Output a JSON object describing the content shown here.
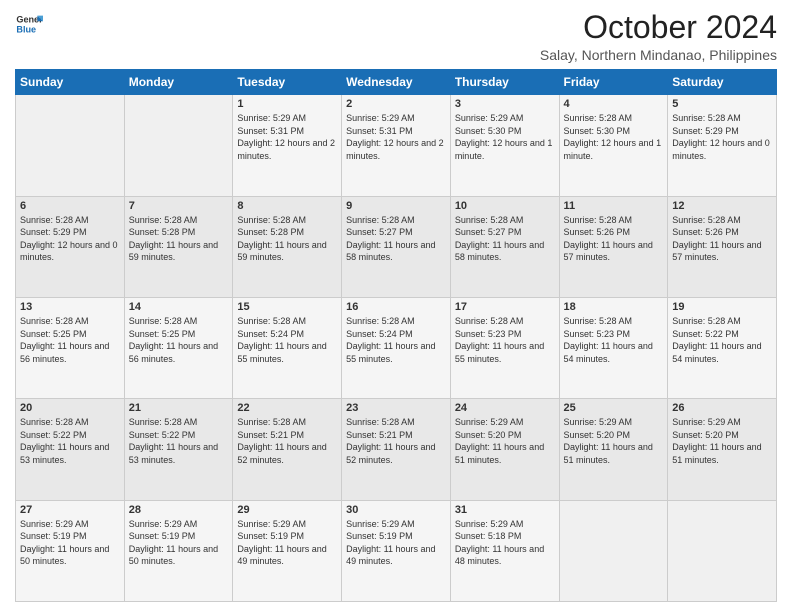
{
  "header": {
    "logo_line1": "General",
    "logo_line2": "Blue",
    "month_title": "October 2024",
    "location": "Salay, Northern Mindanao, Philippines"
  },
  "days_of_week": [
    "Sunday",
    "Monday",
    "Tuesday",
    "Wednesday",
    "Thursday",
    "Friday",
    "Saturday"
  ],
  "weeks": [
    [
      {
        "day": "",
        "sunrise": "",
        "sunset": "",
        "daylight": ""
      },
      {
        "day": "",
        "sunrise": "",
        "sunset": "",
        "daylight": ""
      },
      {
        "day": "1",
        "sunrise": "Sunrise: 5:29 AM",
        "sunset": "Sunset: 5:31 PM",
        "daylight": "Daylight: 12 hours and 2 minutes."
      },
      {
        "day": "2",
        "sunrise": "Sunrise: 5:29 AM",
        "sunset": "Sunset: 5:31 PM",
        "daylight": "Daylight: 12 hours and 2 minutes."
      },
      {
        "day": "3",
        "sunrise": "Sunrise: 5:29 AM",
        "sunset": "Sunset: 5:30 PM",
        "daylight": "Daylight: 12 hours and 1 minute."
      },
      {
        "day": "4",
        "sunrise": "Sunrise: 5:28 AM",
        "sunset": "Sunset: 5:30 PM",
        "daylight": "Daylight: 12 hours and 1 minute."
      },
      {
        "day": "5",
        "sunrise": "Sunrise: 5:28 AM",
        "sunset": "Sunset: 5:29 PM",
        "daylight": "Daylight: 12 hours and 0 minutes."
      }
    ],
    [
      {
        "day": "6",
        "sunrise": "Sunrise: 5:28 AM",
        "sunset": "Sunset: 5:29 PM",
        "daylight": "Daylight: 12 hours and 0 minutes."
      },
      {
        "day": "7",
        "sunrise": "Sunrise: 5:28 AM",
        "sunset": "Sunset: 5:28 PM",
        "daylight": "Daylight: 11 hours and 59 minutes."
      },
      {
        "day": "8",
        "sunrise": "Sunrise: 5:28 AM",
        "sunset": "Sunset: 5:28 PM",
        "daylight": "Daylight: 11 hours and 59 minutes."
      },
      {
        "day": "9",
        "sunrise": "Sunrise: 5:28 AM",
        "sunset": "Sunset: 5:27 PM",
        "daylight": "Daylight: 11 hours and 58 minutes."
      },
      {
        "day": "10",
        "sunrise": "Sunrise: 5:28 AM",
        "sunset": "Sunset: 5:27 PM",
        "daylight": "Daylight: 11 hours and 58 minutes."
      },
      {
        "day": "11",
        "sunrise": "Sunrise: 5:28 AM",
        "sunset": "Sunset: 5:26 PM",
        "daylight": "Daylight: 11 hours and 57 minutes."
      },
      {
        "day": "12",
        "sunrise": "Sunrise: 5:28 AM",
        "sunset": "Sunset: 5:26 PM",
        "daylight": "Daylight: 11 hours and 57 minutes."
      }
    ],
    [
      {
        "day": "13",
        "sunrise": "Sunrise: 5:28 AM",
        "sunset": "Sunset: 5:25 PM",
        "daylight": "Daylight: 11 hours and 56 minutes."
      },
      {
        "day": "14",
        "sunrise": "Sunrise: 5:28 AM",
        "sunset": "Sunset: 5:25 PM",
        "daylight": "Daylight: 11 hours and 56 minutes."
      },
      {
        "day": "15",
        "sunrise": "Sunrise: 5:28 AM",
        "sunset": "Sunset: 5:24 PM",
        "daylight": "Daylight: 11 hours and 55 minutes."
      },
      {
        "day": "16",
        "sunrise": "Sunrise: 5:28 AM",
        "sunset": "Sunset: 5:24 PM",
        "daylight": "Daylight: 11 hours and 55 minutes."
      },
      {
        "day": "17",
        "sunrise": "Sunrise: 5:28 AM",
        "sunset": "Sunset: 5:23 PM",
        "daylight": "Daylight: 11 hours and 55 minutes."
      },
      {
        "day": "18",
        "sunrise": "Sunrise: 5:28 AM",
        "sunset": "Sunset: 5:23 PM",
        "daylight": "Daylight: 11 hours and 54 minutes."
      },
      {
        "day": "19",
        "sunrise": "Sunrise: 5:28 AM",
        "sunset": "Sunset: 5:22 PM",
        "daylight": "Daylight: 11 hours and 54 minutes."
      }
    ],
    [
      {
        "day": "20",
        "sunrise": "Sunrise: 5:28 AM",
        "sunset": "Sunset: 5:22 PM",
        "daylight": "Daylight: 11 hours and 53 minutes."
      },
      {
        "day": "21",
        "sunrise": "Sunrise: 5:28 AM",
        "sunset": "Sunset: 5:22 PM",
        "daylight": "Daylight: 11 hours and 53 minutes."
      },
      {
        "day": "22",
        "sunrise": "Sunrise: 5:28 AM",
        "sunset": "Sunset: 5:21 PM",
        "daylight": "Daylight: 11 hours and 52 minutes."
      },
      {
        "day": "23",
        "sunrise": "Sunrise: 5:28 AM",
        "sunset": "Sunset: 5:21 PM",
        "daylight": "Daylight: 11 hours and 52 minutes."
      },
      {
        "day": "24",
        "sunrise": "Sunrise: 5:29 AM",
        "sunset": "Sunset: 5:20 PM",
        "daylight": "Daylight: 11 hours and 51 minutes."
      },
      {
        "day": "25",
        "sunrise": "Sunrise: 5:29 AM",
        "sunset": "Sunset: 5:20 PM",
        "daylight": "Daylight: 11 hours and 51 minutes."
      },
      {
        "day": "26",
        "sunrise": "Sunrise: 5:29 AM",
        "sunset": "Sunset: 5:20 PM",
        "daylight": "Daylight: 11 hours and 51 minutes."
      }
    ],
    [
      {
        "day": "27",
        "sunrise": "Sunrise: 5:29 AM",
        "sunset": "Sunset: 5:19 PM",
        "daylight": "Daylight: 11 hours and 50 minutes."
      },
      {
        "day": "28",
        "sunrise": "Sunrise: 5:29 AM",
        "sunset": "Sunset: 5:19 PM",
        "daylight": "Daylight: 11 hours and 50 minutes."
      },
      {
        "day": "29",
        "sunrise": "Sunrise: 5:29 AM",
        "sunset": "Sunset: 5:19 PM",
        "daylight": "Daylight: 11 hours and 49 minutes."
      },
      {
        "day": "30",
        "sunrise": "Sunrise: 5:29 AM",
        "sunset": "Sunset: 5:19 PM",
        "daylight": "Daylight: 11 hours and 49 minutes."
      },
      {
        "day": "31",
        "sunrise": "Sunrise: 5:29 AM",
        "sunset": "Sunset: 5:18 PM",
        "daylight": "Daylight: 11 hours and 48 minutes."
      },
      {
        "day": "",
        "sunrise": "",
        "sunset": "",
        "daylight": ""
      },
      {
        "day": "",
        "sunrise": "",
        "sunset": "",
        "daylight": ""
      }
    ]
  ]
}
